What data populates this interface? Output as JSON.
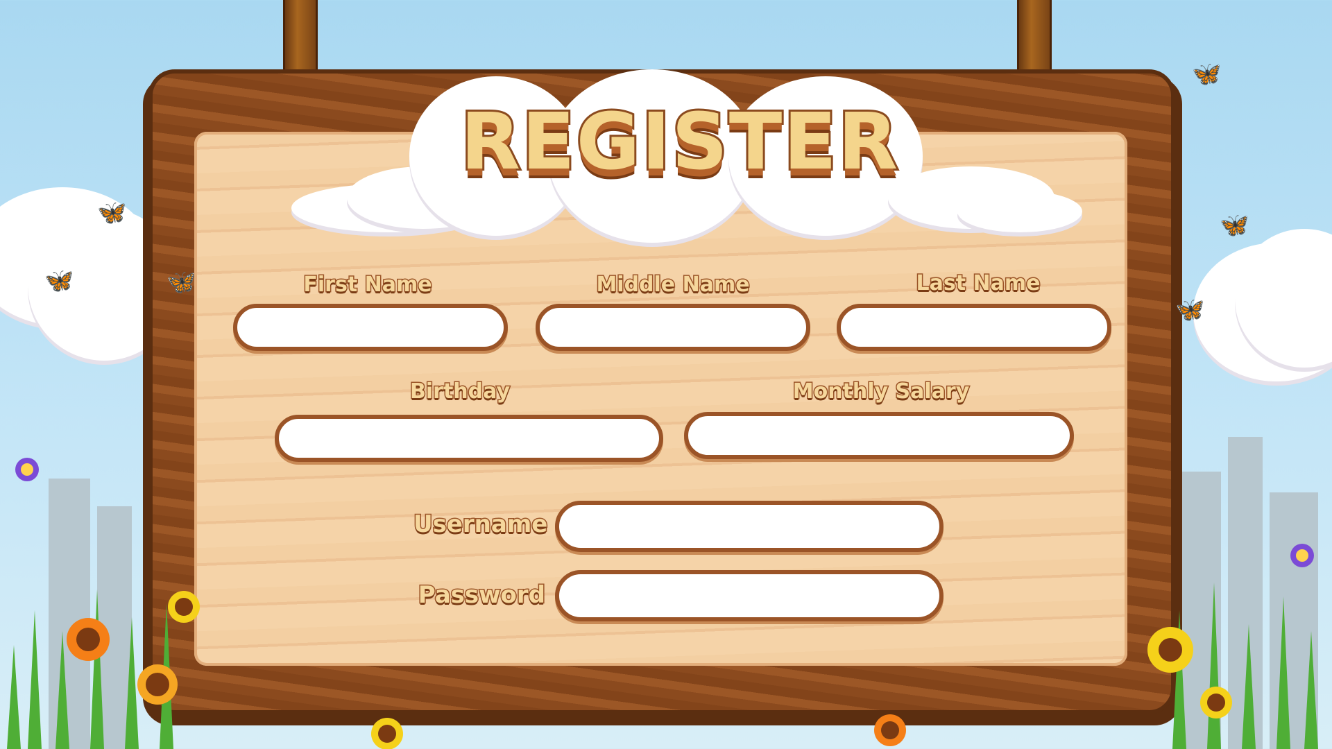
{
  "title": "REGISTER",
  "fields": {
    "first_name": {
      "label": "First Name",
      "value": ""
    },
    "middle_name": {
      "label": "Middle Name",
      "value": ""
    },
    "last_name": {
      "label": "Last Name",
      "value": ""
    },
    "birthday": {
      "label": "Birthday",
      "value": ""
    },
    "salary": {
      "label": "Monthly Salary",
      "value": ""
    },
    "username": {
      "label": "Username",
      "value": ""
    },
    "password": {
      "label": "Password",
      "value": ""
    }
  },
  "colors": {
    "sky": "#a9d8f1",
    "wood_frame": "#8b4a1e",
    "wood_board": "#f3cfa2",
    "label_fill": "#f6d79c",
    "input_border": "#9b5427",
    "grass": "#4fae36"
  }
}
